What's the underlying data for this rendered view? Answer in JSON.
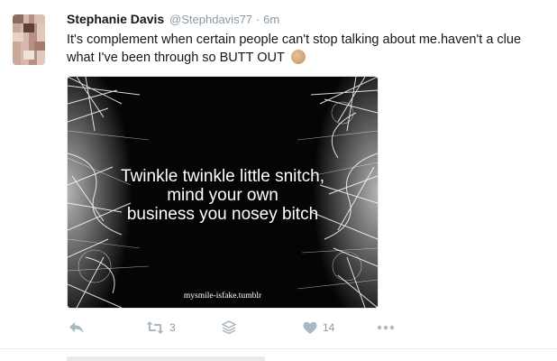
{
  "tweet": {
    "author_name": "Stephanie Davis",
    "author_handle": "@Stephdavis77",
    "separator": "·",
    "time": "6m",
    "text": "It's complement when certain people can't stop talking about me.haven't a clue what I've been through so BUTT OUT",
    "emoji": "clapping-hands-emoji"
  },
  "media": {
    "quote": "Twinkle twinkle little snitch,\nmind your own\nbusiness you nosey bitch",
    "watermark": "mysmile-isfake.tumblr"
  },
  "actions": {
    "reply_icon": "reply-icon",
    "retweet_icon": "retweet-icon",
    "retweet_count": "3",
    "buffer_icon": "layers-icon",
    "like_icon": "heart-icon",
    "like_count": "14",
    "more_icon": "more-dots-icon"
  },
  "colors": {
    "text": "#14171a",
    "muted": "#8899a6",
    "icon": "#aab8c2",
    "divider": "#e6ecf0"
  }
}
